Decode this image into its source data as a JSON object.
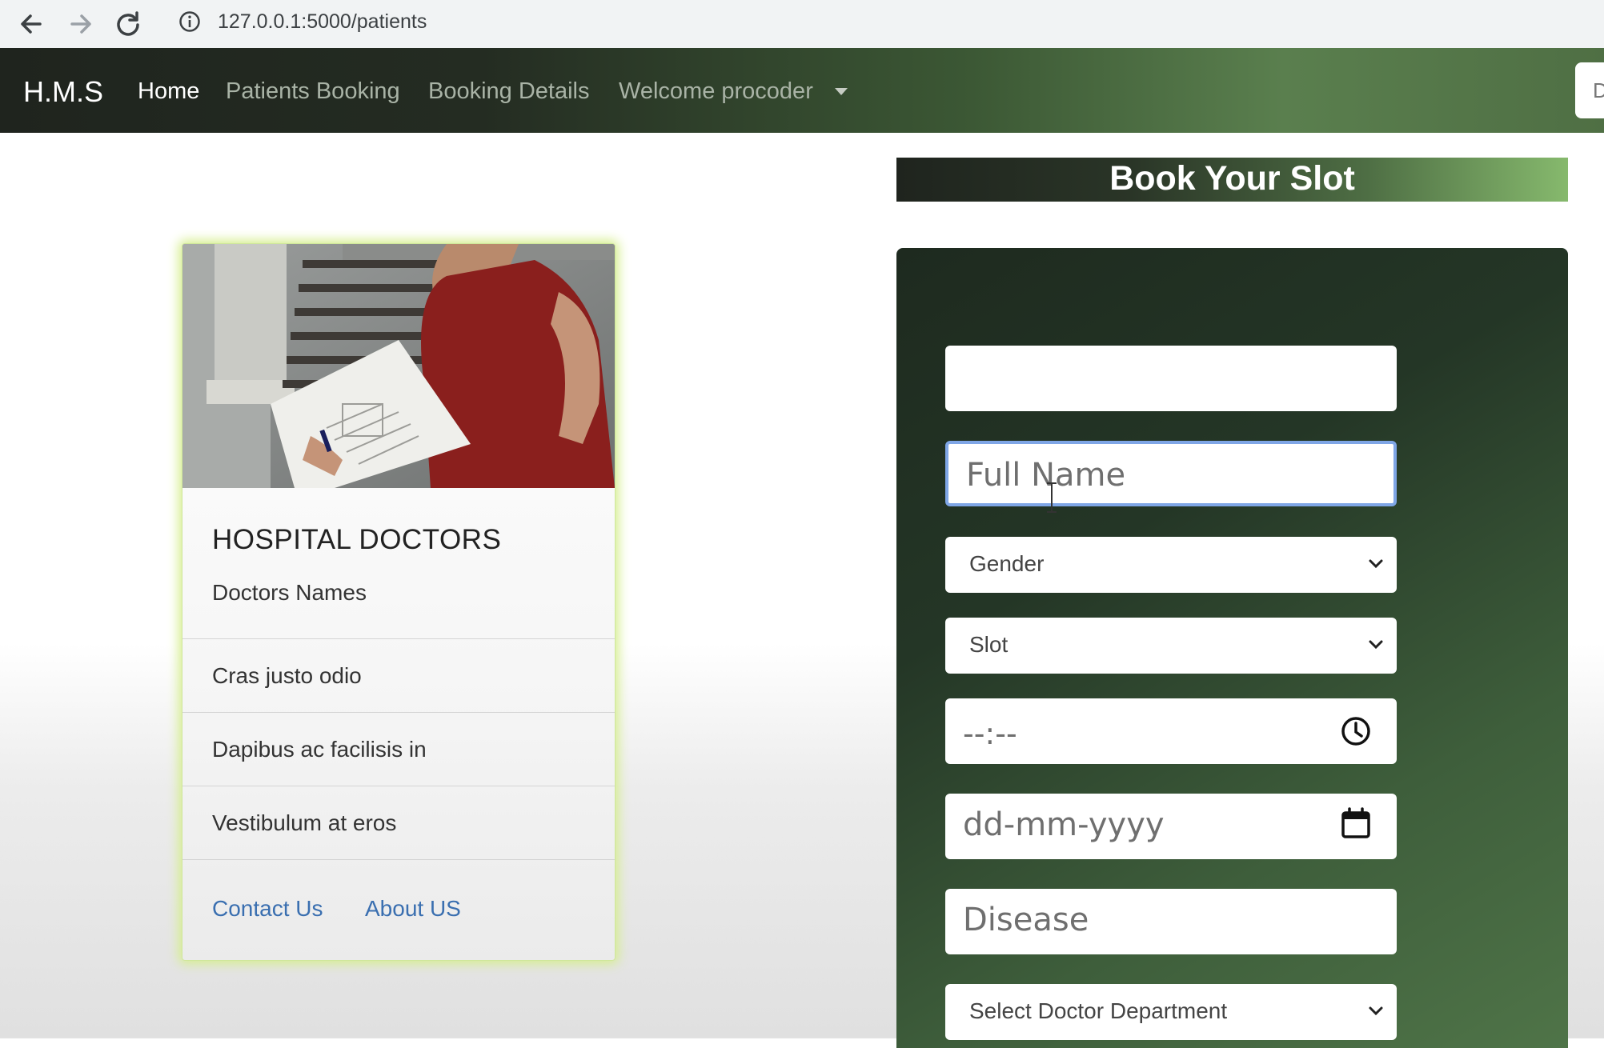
{
  "browser": {
    "url": "127.0.0.1:5000/patients"
  },
  "navbar": {
    "brand": "H.M.S",
    "links": [
      "Home",
      "Patients Booking",
      "Booking Details",
      "Welcome procoder"
    ],
    "right_button_text": "D"
  },
  "card": {
    "title": "HOSPITAL DOCTORS",
    "subtitle": "Doctors Names",
    "items": [
      "Cras justo odio",
      "Dapibus ac facilisis in",
      "Vestibulum at eros"
    ],
    "links": [
      "Contact Us",
      "About US"
    ]
  },
  "booking": {
    "title": "Book Your Slot",
    "fields": {
      "email_value": "",
      "full_name_placeholder": "Full Name",
      "gender_select": "Gender",
      "slot_select": "Slot",
      "time_placeholder": "--:--",
      "date_placeholder": "dd-mm-yyyy",
      "disease_placeholder": "Disease",
      "department_select": "Select Doctor Department"
    }
  },
  "colors": {
    "accent_green": "#4f7448",
    "link_blue": "#3a6fb0",
    "focus_ring": "#7fa6e6"
  }
}
